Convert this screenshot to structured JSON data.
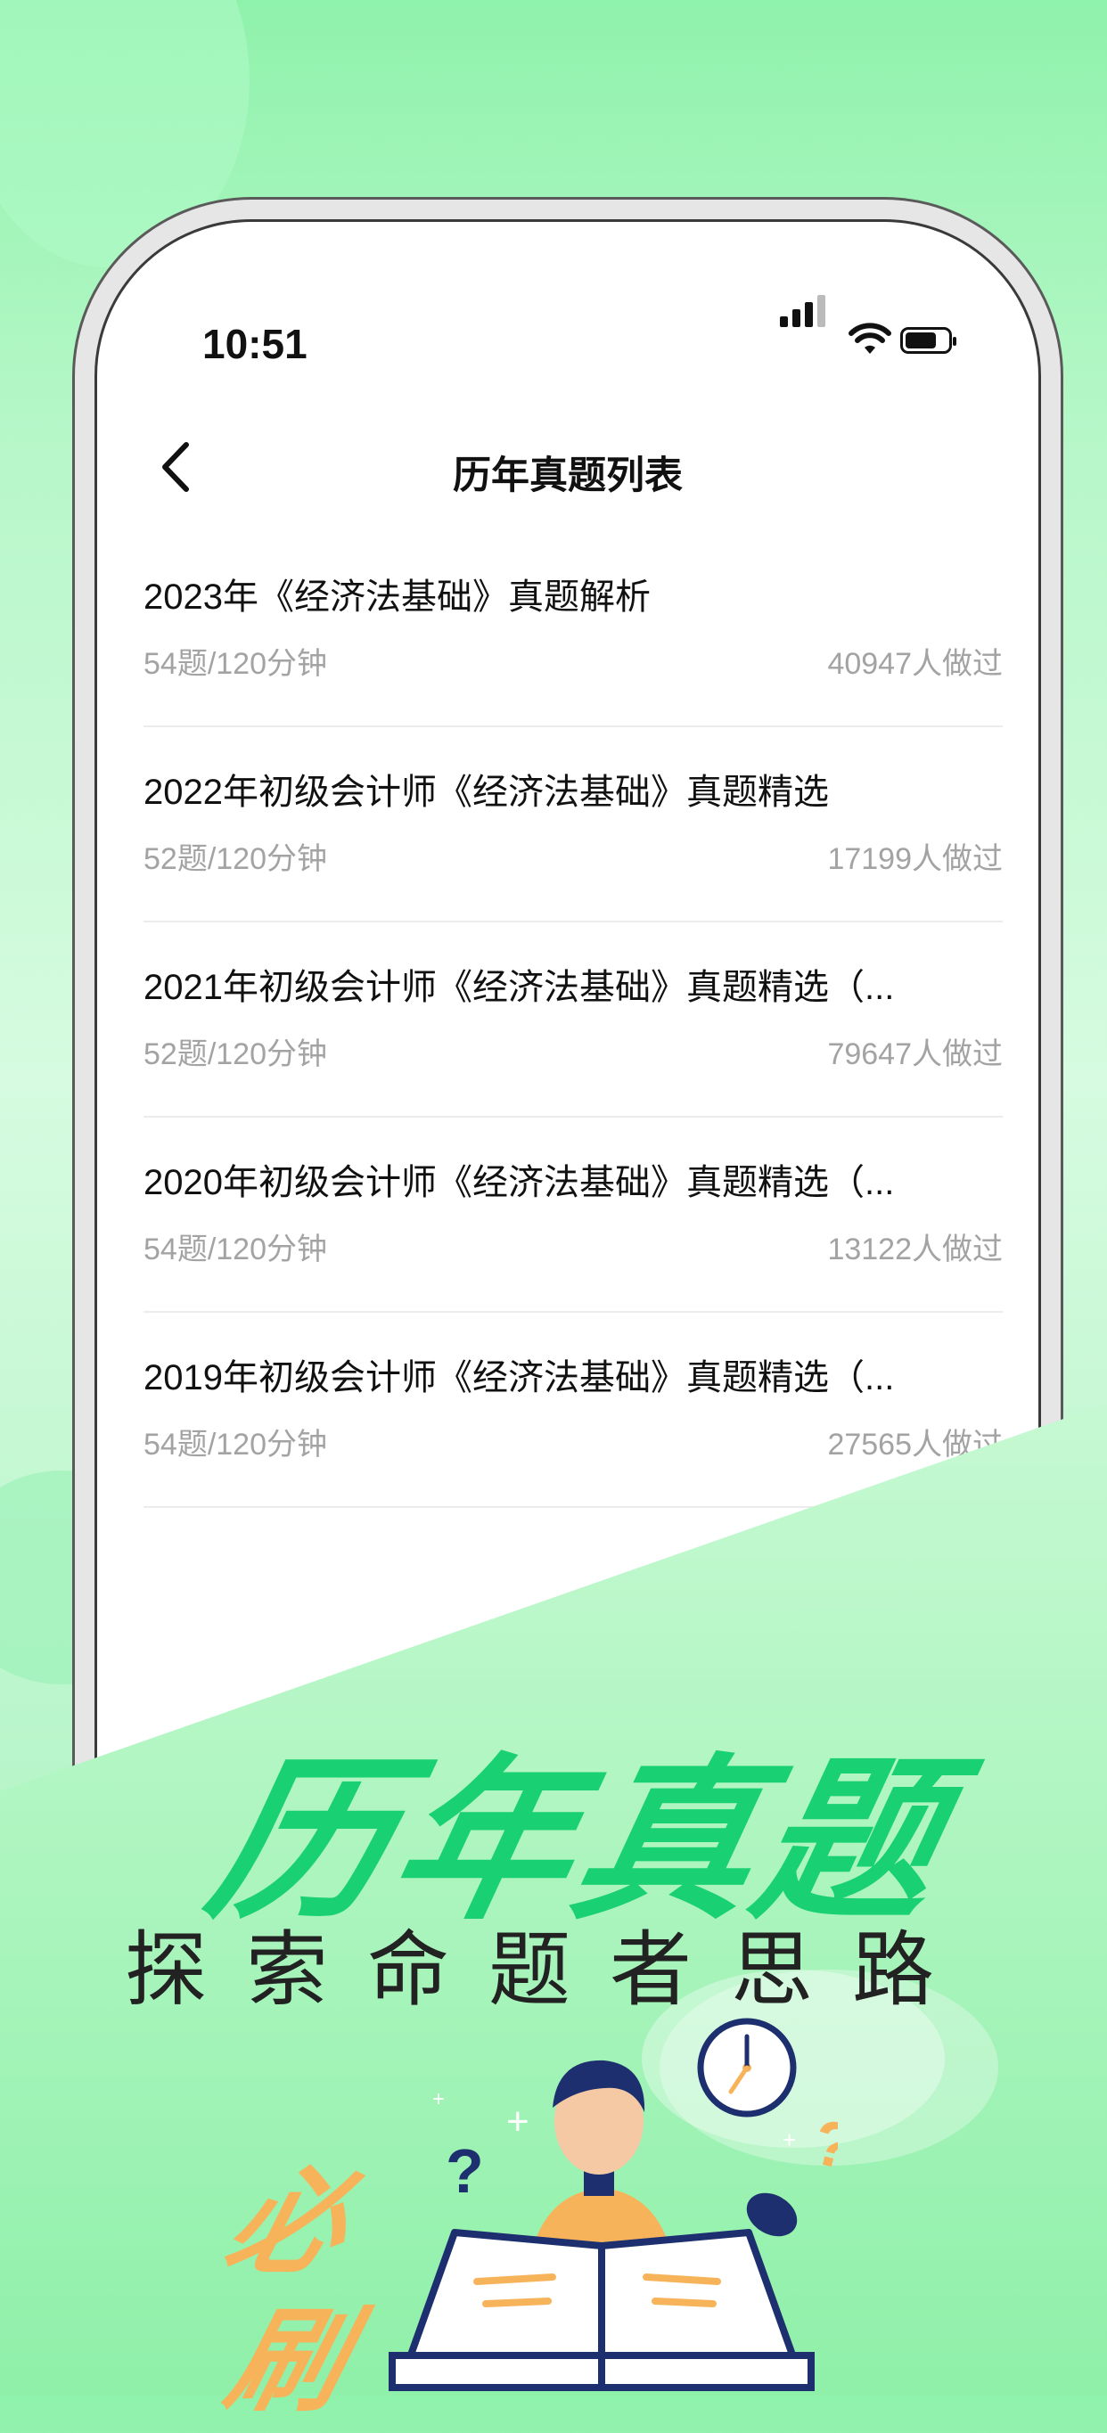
{
  "status": {
    "time": "10:51"
  },
  "nav": {
    "title": "历年真题列表"
  },
  "list": [
    {
      "title": "2023年《经济法基础》真题解析",
      "meta": "54题/120分钟",
      "count": "40947人做过"
    },
    {
      "title": "2022年初级会计师《经济法基础》真题精选",
      "meta": "52题/120分钟",
      "count": "17199人做过"
    },
    {
      "title": "2021年初级会计师《经济法基础》真题精选（...",
      "meta": "52题/120分钟",
      "count": "79647人做过"
    },
    {
      "title": "2020年初级会计师《经济法基础》真题精选（...",
      "meta": "54题/120分钟",
      "count": "13122人做过"
    },
    {
      "title": "2019年初级会计师《经济法基础》真题精选（...",
      "meta": "54题/120分钟",
      "count": "27565人做过"
    }
  ],
  "promo": {
    "title": "历年真题",
    "subtitle": "探索命题者思路",
    "bi": "必",
    "shua": "刷"
  },
  "colors": {
    "accent": "#19d172",
    "orange": "#f7b35a",
    "background": "#b6f7c8"
  },
  "icons": [
    "back-icon",
    "signal-icon",
    "wifi-icon",
    "battery-icon",
    "clock-icon",
    "book-icon"
  ]
}
